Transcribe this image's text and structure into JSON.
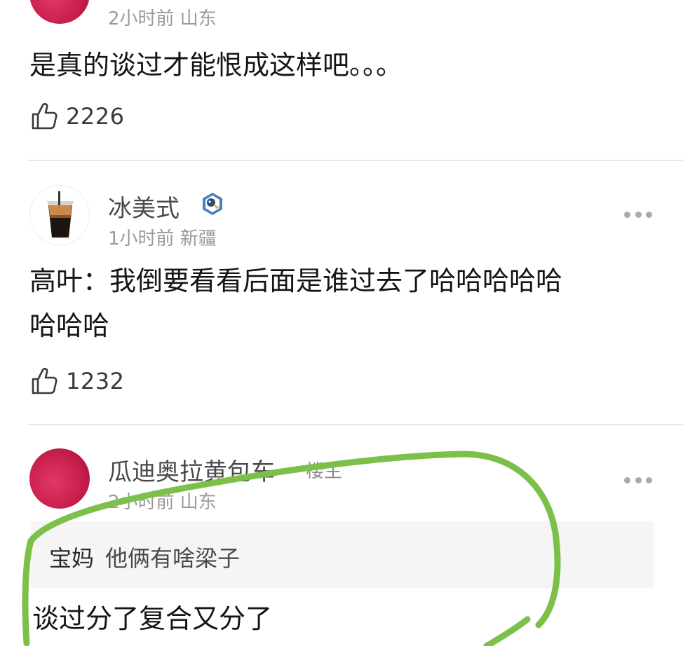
{
  "comments": [
    {
      "meta": "2小时前 山东",
      "text": "是真的谈过才能恨成这样吧。。。",
      "likes": "2226"
    },
    {
      "username": "冰美式",
      "meta": "1小时前 新疆",
      "text_line1": "高叶：我倒要看看后面是谁过去了哈哈哈哈哈",
      "text_line2": "哈哈哈",
      "likes": "1232"
    },
    {
      "username": "瓜迪奥拉黄包车",
      "op_tag": "楼主",
      "meta": "2小时前 山东",
      "quote_author": "宝妈",
      "quote_text": "他俩有啥梁子",
      "text": "谈过分了复合又分了"
    }
  ],
  "colors": {
    "annotation_stroke": "#7cc04a",
    "avatar_pink": "#c91f4e"
  },
  "icons": {
    "like": "thumbs-up-icon",
    "more": "more-dots-icon",
    "badge": "verified-badge-icon"
  }
}
